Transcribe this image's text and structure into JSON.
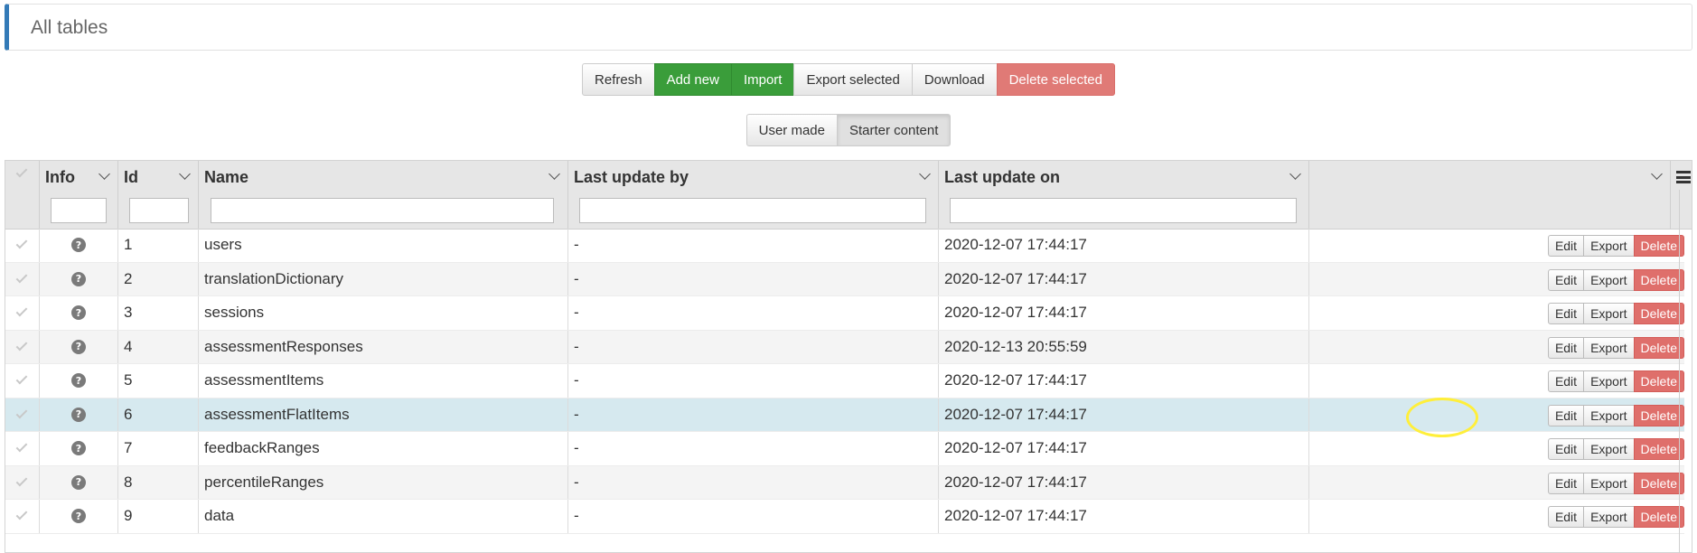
{
  "panel": {
    "title": "All tables",
    "accent": "#337ab7"
  },
  "toolbar": {
    "refresh": "Refresh",
    "add_new": "Add new",
    "import": "Import",
    "export_selected": "Export selected",
    "download": "Download",
    "delete_selected": "Delete selected"
  },
  "filter_toggle": {
    "user_made": "User made",
    "starter_content": "Starter content",
    "active": "Starter content"
  },
  "columns": {
    "info": "Info",
    "id": "Id",
    "name": "Name",
    "last_update_by": "Last update by",
    "last_update_on": "Last update on"
  },
  "row_actions": {
    "edit": "Edit",
    "export": "Export",
    "delete": "Delete"
  },
  "rows": [
    {
      "id": "1",
      "name": "users",
      "by": "-",
      "on": "2020-12-07 17:44:17"
    },
    {
      "id": "2",
      "name": "translationDictionary",
      "by": "-",
      "on": "2020-12-07 17:44:17"
    },
    {
      "id": "3",
      "name": "sessions",
      "by": "-",
      "on": "2020-12-07 17:44:17"
    },
    {
      "id": "4",
      "name": "assessmentResponses",
      "by": "-",
      "on": "2020-12-13 20:55:59"
    },
    {
      "id": "5",
      "name": "assessmentItems",
      "by": "-",
      "on": "2020-12-07 17:44:17"
    },
    {
      "id": "6",
      "name": "assessmentFlatItems",
      "by": "-",
      "on": "2020-12-07 17:44:17"
    },
    {
      "id": "7",
      "name": "feedbackRanges",
      "by": "-",
      "on": "2020-12-07 17:44:17"
    },
    {
      "id": "8",
      "name": "percentileRanges",
      "by": "-",
      "on": "2020-12-07 17:44:17"
    },
    {
      "id": "9",
      "name": "data",
      "by": "-",
      "on": "2020-12-07 17:44:17"
    }
  ],
  "selected_row_id": "6",
  "icons": {
    "info": "help-circle-icon",
    "menu": "menu-icon",
    "check": "check-icon",
    "sort": "chevron-down-icon"
  }
}
